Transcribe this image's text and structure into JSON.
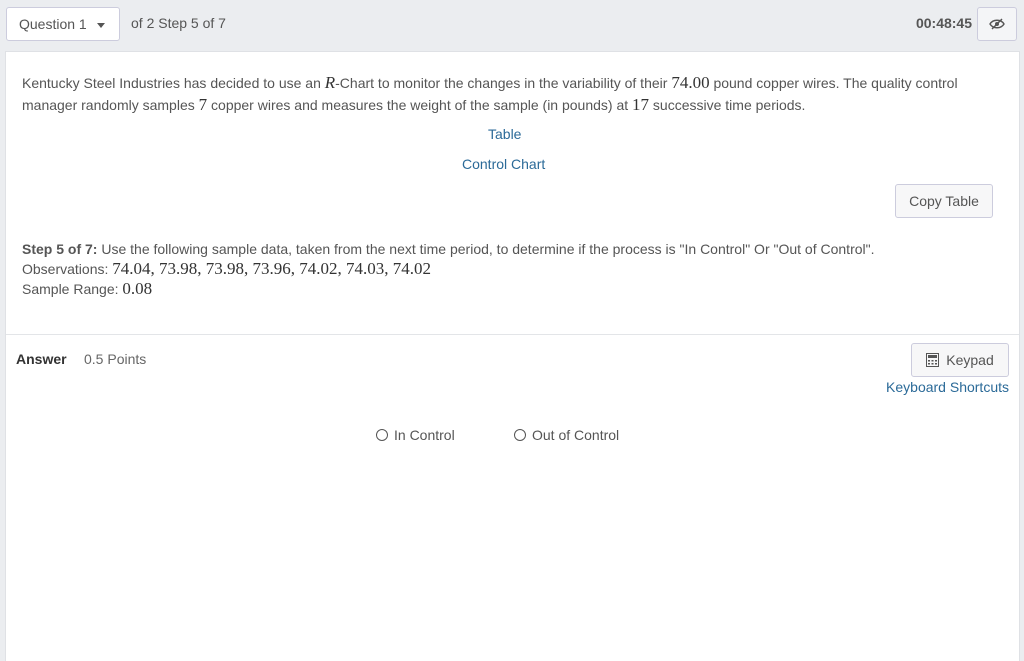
{
  "header": {
    "question_label": "Question 1",
    "step_text": "of 2 Step 5 of 7",
    "timer": "00:48:45",
    "hide_icon": "eye-slash-icon"
  },
  "problem": {
    "p1": "Kentucky Steel Industries has decided to use an ",
    "r_symbol": "R",
    "p2": "-Chart to monitor the changes in the variability of their ",
    "weight": "74.00",
    "p3": " pound copper wires. The quality control manager randomly samples ",
    "sample_size": "7",
    "p4": " copper wires and measures the weight of the sample (in pounds) at ",
    "periods": "17",
    "p5": " successive time periods."
  },
  "links": {
    "table": "Table",
    "control_chart": "Control Chart"
  },
  "copy_table_label": "Copy Table",
  "step": {
    "label": "Step 5 of 7:",
    "text": " Use the following sample data, taken from the next time period, to determine if the process is \"In Control\" Or \"Out of Control\".",
    "observations_label": "Observations: ",
    "observations_value": "74.04, 73.98, 73.98, 73.96, 74.02, 74.03, 74.02",
    "range_label": "Sample Range: ",
    "range_value": "0.08"
  },
  "answer": {
    "label": "Answer",
    "points": "0.5 Points",
    "keypad_label": "Keypad",
    "keypad_icon": "calculator-icon",
    "keyboard_shortcuts": "Keyboard Shortcuts",
    "options": [
      "In Control",
      "Out of Control"
    ]
  }
}
